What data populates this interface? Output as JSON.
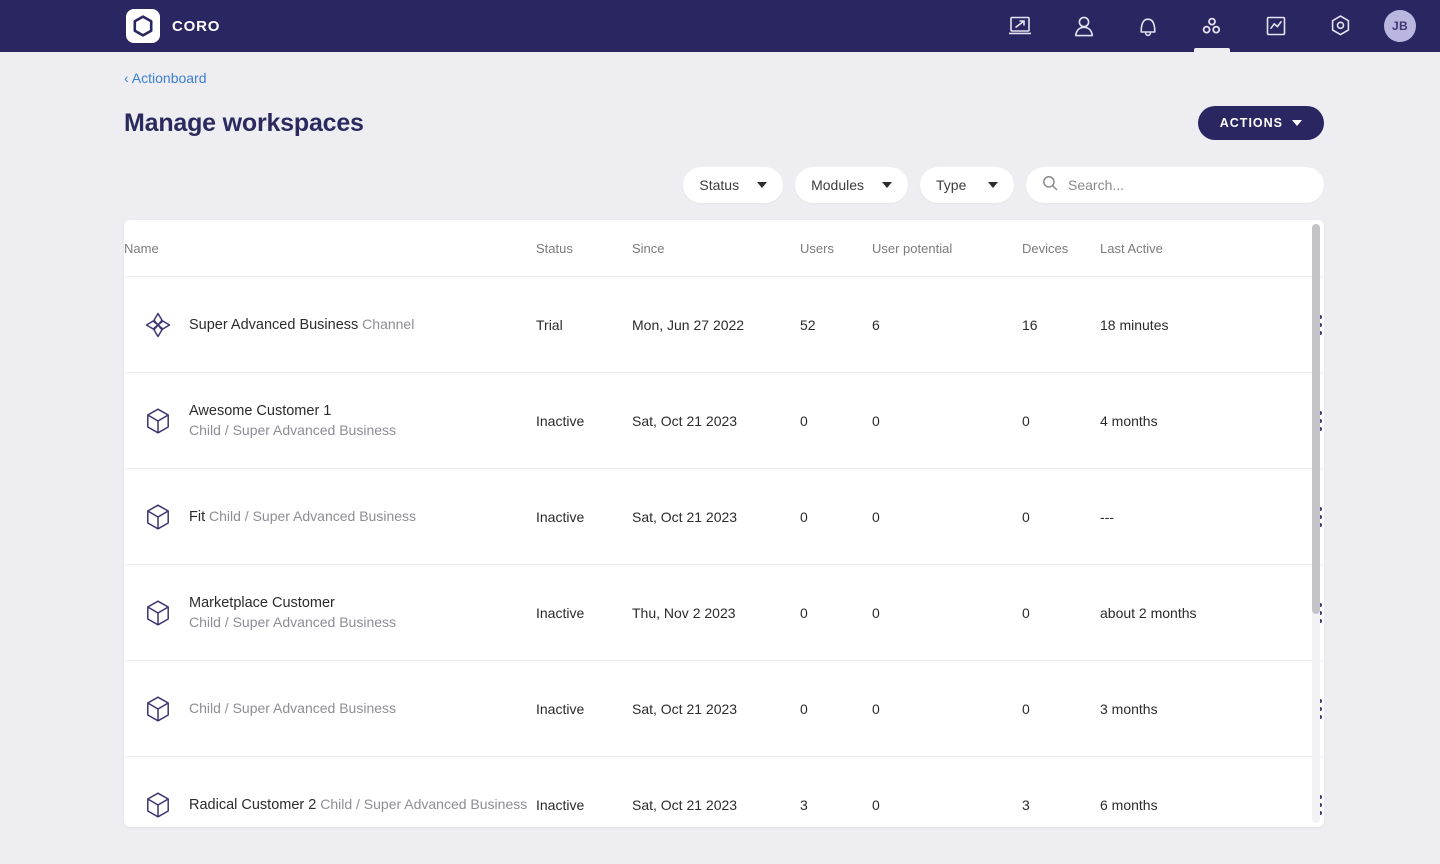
{
  "topnav": {
    "brand_name": "CORO",
    "logo_icon": "coro-hexagon-logo",
    "items": [
      {
        "icon": "dashboard-laptop-icon",
        "active": false
      },
      {
        "icon": "user-icon",
        "active": false
      },
      {
        "icon": "bell-icon",
        "active": false
      },
      {
        "icon": "workspaces-dots-icon",
        "active": true
      },
      {
        "icon": "analytics-chart-icon",
        "active": false
      },
      {
        "icon": "settings-hexagon-icon",
        "active": false
      }
    ],
    "avatar_initials": "JB"
  },
  "header": {
    "breadcrumb": "‹ Actionboard",
    "title": "Manage workspaces",
    "actions_label": "ACTIONS"
  },
  "filters": {
    "status_label": "Status",
    "modules_label": "Modules",
    "type_label": "Type",
    "search_placeholder": "Search...",
    "search_value": ""
  },
  "table": {
    "columns": [
      "Name",
      "Status",
      "Since",
      "Users",
      "User potential",
      "Devices",
      "Last Active"
    ],
    "rows": [
      {
        "icon": "channel-star-icon",
        "name": "Super Advanced Business",
        "subtitle": "Channel",
        "status": "Trial",
        "since": "Mon, Jun 27 2022",
        "users": "52",
        "user_potential": "6",
        "devices": "16",
        "last_active": "18 minutes"
      },
      {
        "icon": "workspace-cube-icon",
        "name": "Awesome Customer 1",
        "subtitle": "Child / Super Advanced Business",
        "status": "Inactive",
        "since": "Sat, Oct 21 2023",
        "users": "0",
        "user_potential": "0",
        "devices": "0",
        "last_active": "4 months"
      },
      {
        "icon": "workspace-cube-icon",
        "name": "Fit",
        "subtitle": "Child / Super Advanced Business",
        "status": "Inactive",
        "since": "Sat, Oct 21 2023",
        "users": "0",
        "user_potential": "0",
        "devices": "0",
        "last_active": "---"
      },
      {
        "icon": "workspace-cube-icon",
        "name": "Marketplace Customer",
        "subtitle": "Child / Super Advanced Business",
        "status": "Inactive",
        "since": "Thu, Nov 2 2023",
        "users": "0",
        "user_potential": "0",
        "devices": "0",
        "last_active": "about 2 months"
      },
      {
        "icon": "workspace-cube-icon",
        "name": "",
        "subtitle": "Child / Super Advanced Business",
        "status": "Inactive",
        "since": "Sat, Oct 21 2023",
        "users": "0",
        "user_potential": "0",
        "devices": "0",
        "last_active": "3 months"
      },
      {
        "icon": "workspace-cube-icon",
        "name": "Radical Customer 2",
        "subtitle": "Child / Super Advanced Business",
        "status": "Inactive",
        "since": "Sat, Oct 21 2023",
        "users": "3",
        "user_potential": "0",
        "devices": "3",
        "last_active": "6 months"
      }
    ],
    "row_menu_icon": "kebab-menu-icon"
  },
  "colors": {
    "brand_navy": "#2a2662",
    "page_bg": "#eeeef2",
    "link_blue": "#3d7fd0",
    "avatar_bg": "#b9b6e0"
  }
}
